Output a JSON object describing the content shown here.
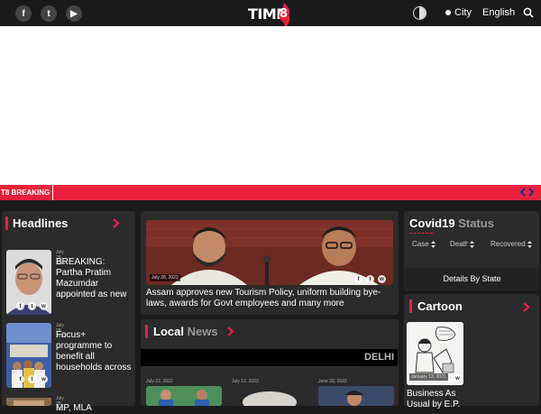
{
  "header": {
    "social": [
      {
        "name": "facebook-icon",
        "glyph": "f"
      },
      {
        "name": "twitter-icon",
        "glyph": "t"
      },
      {
        "name": "youtube-icon",
        "glyph": "▶"
      }
    ],
    "logo_text": "TIME",
    "logo_digit": "8",
    "city_label": "City",
    "language_label": "English"
  },
  "breaking": {
    "label": "T8 BREAKING"
  },
  "headlines": {
    "title": "Headlines",
    "items": [
      {
        "date": "July 28, 2022",
        "title": "BREAKING: Partha Pratim Mazumdar appointed as new"
      },
      {
        "date": "July 28, 2022",
        "title": "Focus+ programme to benefit all households across"
      },
      {
        "date": "July 28, 2022",
        "title": "MP, MLA"
      }
    ]
  },
  "featured": {
    "date": "July 28, 2022",
    "title": "Assam approves new Tourism Policy, uniform building bye-laws, awards for Govt employees and many more"
  },
  "local_news": {
    "title_main": "Local",
    "title_accent": "News",
    "city": "DELHI",
    "dates": [
      "July 22, 2022",
      "July 12, 2022",
      "June 29, 2022"
    ]
  },
  "covid": {
    "title_main": "Covid19",
    "title_accent": "Status",
    "columns": [
      "Case",
      "Death",
      "Recovered"
    ],
    "details_button": "Details By State"
  },
  "cartoon": {
    "title": "Cartoon",
    "date": "January 13, 2021",
    "caption": "Business As Usual by E.P."
  },
  "colors": {
    "accent": "#e9213e",
    "background": "#1b1b1b",
    "card": "#2b2b2b"
  }
}
